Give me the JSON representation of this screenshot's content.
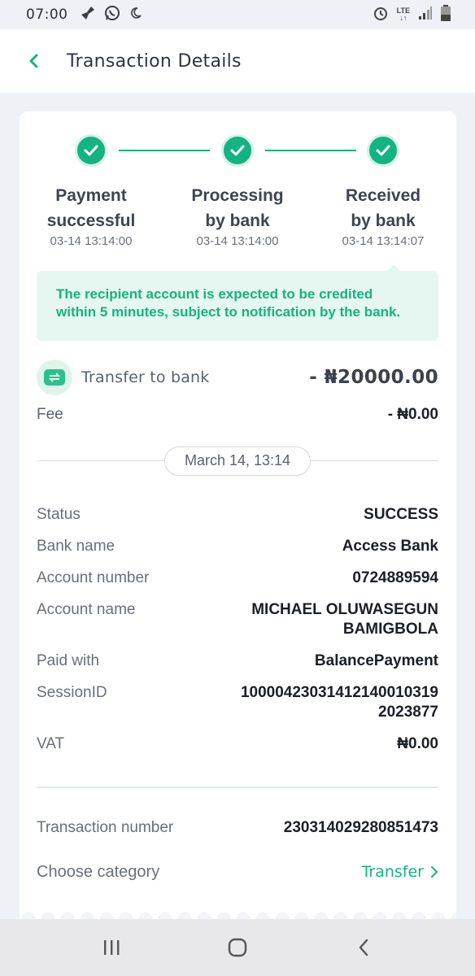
{
  "status_bar": {
    "time": "07:00",
    "network": "LTE"
  },
  "header": {
    "title": "Transaction Details",
    "back_icon": "chevron-left-icon"
  },
  "steps": [
    {
      "line1": "Payment",
      "line2": "successful",
      "time": "03-14 13:14:00"
    },
    {
      "line1": "Processing",
      "line2": "by bank",
      "time": "03-14 13:14:00"
    },
    {
      "line1": "Received",
      "line2": "by bank",
      "time": "03-14 13:14:07"
    }
  ],
  "notice": {
    "line1": "The recipient account is expected to be credited",
    "line2": "within 5 minutes, subject to notification by the bank."
  },
  "transfer": {
    "label": "Transfer to bank",
    "amount": "- ₦20000.00"
  },
  "fee": {
    "label": "Fee",
    "value": "- ₦0.00"
  },
  "date_pill": "March 14, 13:14",
  "details": {
    "status": {
      "label": "Status",
      "value": "SUCCESS"
    },
    "bank_name": {
      "label": "Bank name",
      "value": "Access Bank"
    },
    "account_number": {
      "label": "Account number",
      "value": "0724889594"
    },
    "account_name": {
      "label": "Account name",
      "line1": "MICHAEL OLUWASEGUN",
      "line2": "BAMIGBOLA"
    },
    "paid_with": {
      "label": "Paid with",
      "value": "BalancePayment"
    },
    "session_id": {
      "label": "SessionID",
      "line1": "1000042303141214001031​9",
      "line2": "2023877"
    },
    "vat": {
      "label": "VAT",
      "value": "₦0.00"
    }
  },
  "transaction_number": {
    "label": "Transaction number",
    "value": "230314029280851473"
  },
  "category": {
    "label": "Choose category",
    "value": "Transfer"
  },
  "colors": {
    "accent": "#14b382",
    "notice_bg": "#e5f7f0",
    "page_bg": "#eef2f7"
  }
}
